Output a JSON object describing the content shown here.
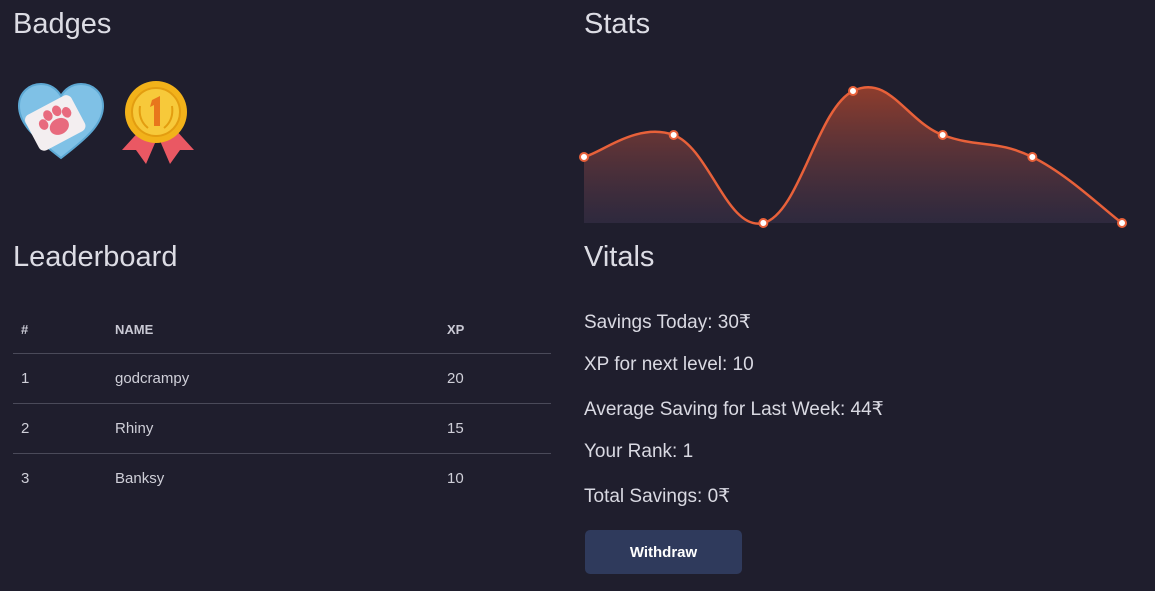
{
  "badges": {
    "title": "Badges",
    "items": [
      {
        "name": "heart-paw-badge",
        "colors": {
          "heart": "#7fc1e6",
          "paw": "#e86a7e",
          "card": "#f3eef0"
        }
      },
      {
        "name": "first-place-medal",
        "colors": {
          "medal": "#f2b21a",
          "ribbon": "#ea5863",
          "number": "#e8761c"
        }
      }
    ]
  },
  "stats": {
    "title": "Stats"
  },
  "chart_data": {
    "type": "area",
    "x": [
      0,
      1,
      2,
      3,
      4,
      5,
      6
    ],
    "values": [
      15,
      20,
      0,
      30,
      20,
      15,
      0
    ],
    "ylim": [
      0,
      30
    ],
    "grid": false,
    "title": "",
    "xlabel": "",
    "ylabel": "",
    "colors": {
      "line": "#e8613a",
      "point_fill": "#ffffff",
      "point_stroke": "#e8613a"
    }
  },
  "leaderboard": {
    "title": "Leaderboard",
    "columns": [
      "#",
      "NAME",
      "XP"
    ],
    "rows": [
      {
        "rank": "1",
        "name": "godcrampy",
        "xp": "20"
      },
      {
        "rank": "2",
        "name": "Rhiny",
        "xp": "15"
      },
      {
        "rank": "3",
        "name": "Banksy",
        "xp": "10"
      }
    ]
  },
  "vitals": {
    "title": "Vitals",
    "savings_today": "Savings Today: 30₹",
    "xp_next_level": "XP for next level: 10",
    "avg_saving_last_week": "Average Saving for Last Week: 44₹",
    "your_rank": "Your Rank: 1",
    "total_savings": "Total Savings: 0₹",
    "withdraw_label": "Withdraw"
  },
  "theme": {
    "background": "#1f1e2d",
    "button": "#2f3a5c",
    "accent": "#e8613a"
  }
}
